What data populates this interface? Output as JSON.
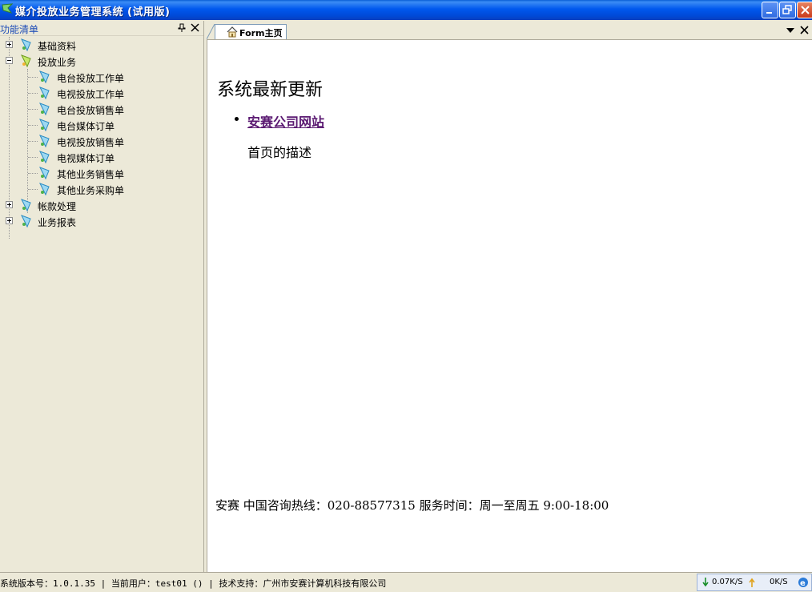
{
  "window": {
    "title": "媒介投放业务管理系统 (试用版)"
  },
  "left_panel": {
    "title": "功能清单",
    "tree": [
      {
        "label": "基础资料",
        "expanded": false,
        "children": []
      },
      {
        "label": "投放业务",
        "expanded": true,
        "children": [
          {
            "label": "电台投放工作单"
          },
          {
            "label": "电视投放工作单"
          },
          {
            "label": "电台投放销售单"
          },
          {
            "label": "电台媒体订单"
          },
          {
            "label": "电视投放销售单"
          },
          {
            "label": "电视媒体订单"
          },
          {
            "label": "其他业务销售单"
          },
          {
            "label": "其他业务采购单"
          }
        ]
      },
      {
        "label": "帐款处理",
        "expanded": false,
        "children": []
      },
      {
        "label": "业务报表",
        "expanded": false,
        "children": []
      }
    ]
  },
  "tabs": [
    {
      "label": "Form主页",
      "active": true
    }
  ],
  "main": {
    "heading": "系统最新更新",
    "link_text": "安赛公司网站",
    "description": "首页的描述",
    "footer": "安赛  中国咨询热线：020-88577315 服务时间：周一至周五  9:00-18:00"
  },
  "status_bar": {
    "text": "系统版本号：1.0.1.35 | 当前用户：test01 () | 技术支持：广州市安赛计算机科技有限公司",
    "download_rate": "0.07K/S",
    "upload_rate": "0K/S"
  },
  "colors": {
    "titlebar_blue": "#0058EE",
    "link_purple": "#5B1A72",
    "panel_title_blue": "#1E4DB7",
    "background": "#ECE9D8"
  }
}
